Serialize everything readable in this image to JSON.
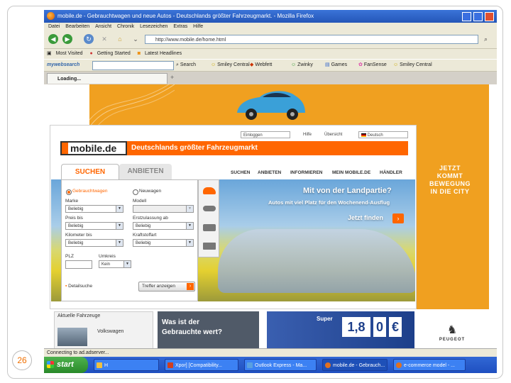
{
  "browser": {
    "title": "mobile.de - Gebrauchtwagen und neue Autos - Deutschlands größter Fahrzeugmarkt. - Mozilla Firefox",
    "menu": [
      "Datei",
      "Bearbeiten",
      "Ansicht",
      "Chronik",
      "Lesezeichen",
      "Extras",
      "Hilfe"
    ],
    "url": "http://www.mobile.de/home.html",
    "bookmarks": [
      "Most Visited",
      "Getting Started",
      "Latest Headlines"
    ],
    "toolbar": {
      "brand": "mywebsearch",
      "search_btn": "Search",
      "items": [
        "Smiley Central",
        "Webfett",
        "Zwinky",
        "Games",
        "FanSense",
        "Smiley Central"
      ]
    },
    "tab_label": "Loading...",
    "status": "Connecting to ad.adserver..."
  },
  "ad": {
    "headline": [
      "JETZT",
      "KOMMT",
      "BEWEGUNG",
      "IN DIE CITY"
    ],
    "brand": "PEUGEOT"
  },
  "site": {
    "top_select_lang": "Deutsch",
    "top_select_login": "Einloggen",
    "top_links": [
      "Hilfe",
      "Übersicht"
    ],
    "logo": "mobile.de",
    "slogan": "Deutschlands größter Fahrzeugmarkt",
    "tabs": [
      "SUCHEN",
      "ANBIETEN"
    ],
    "nav": [
      "SUCHEN",
      "ANBIETEN",
      "INFORMIEREN",
      "MEIN MOBILE.DE",
      "HÄNDLER"
    ],
    "hero": {
      "title": "Mit von der Landpartie?",
      "subtitle": "Autos mit viel Platz für den Wochenend-Ausflug",
      "cta": "Jetzt finden"
    },
    "form": {
      "radio_used": "Gebrauchtwagen",
      "radio_new": "Neuwagen",
      "label_make": "Marke",
      "label_model": "Modell",
      "label_price": "Preis bis",
      "label_firstreg": "Erstzulassung ab",
      "label_mileage": "Kilometer bis",
      "label_fuel": "Kraftstoffart",
      "label_zip": "PLZ",
      "label_radius": "Umkreis",
      "any": "Beliebig",
      "radius_val": "Kein",
      "details_link": "Detailsuche",
      "search_btn": "Treffer anzeigen"
    },
    "bottom": {
      "ad_heading": "Aktuelle Fahrzeuge",
      "car_label": "Volkswagen",
      "teaser": [
        "Was ist der",
        "Gebrauchte wert?"
      ],
      "price": [
        "Super",
        "1,8",
        "0",
        "€"
      ]
    }
  },
  "taskbar": {
    "start": "start",
    "items": [
      "H",
      "Xpor] [Compatibility...",
      "Outlook Express - Ma...",
      "mobile.de - Gebrauch...",
      "e-commerce model - ..."
    ]
  },
  "slide_number": "26",
  "colors": {
    "accent": "#ff6600",
    "ad_orange": "#f0a020"
  }
}
